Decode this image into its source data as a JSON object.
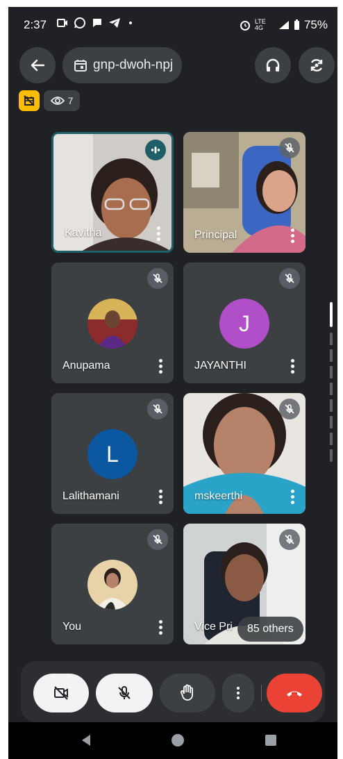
{
  "status_bar": {
    "time": "2:37",
    "battery": "75%",
    "network": "LTE 4G"
  },
  "top_bar": {
    "meeting_code": "gnp-dwoh-npj",
    "viewer_count": "7"
  },
  "tiles": [
    {
      "name": "Kavitha",
      "type": "video",
      "state": "speaking"
    },
    {
      "name": "Principal",
      "type": "video",
      "state": "muted"
    },
    {
      "name": "Anupama",
      "type": "photo-avatar",
      "state": "muted"
    },
    {
      "name": "JAYANTHI",
      "type": "letter-avatar",
      "letter": "J",
      "color": "#b04fc8",
      "state": "muted"
    },
    {
      "name": "Lalithamani",
      "type": "letter-avatar",
      "letter": "L",
      "color": "#0b57a0",
      "state": "muted"
    },
    {
      "name": "mskeerthi",
      "type": "video",
      "state": "muted"
    },
    {
      "name": "You",
      "type": "photo-avatar",
      "state": "muted"
    },
    {
      "name": "Vice Pri",
      "type": "video",
      "state": "muted"
    }
  ],
  "others_label": "85 others",
  "controls": {
    "camera": "camera-off",
    "mic": "mic-off",
    "raise_hand": "raise-hand",
    "more": "more-options",
    "end_call": "end-call"
  },
  "colors": {
    "background": "#202124",
    "tile": "#3c4043",
    "active_border": "#1e5f6a",
    "end_call": "#ea4335",
    "warning_chip": "#fbbc04"
  }
}
